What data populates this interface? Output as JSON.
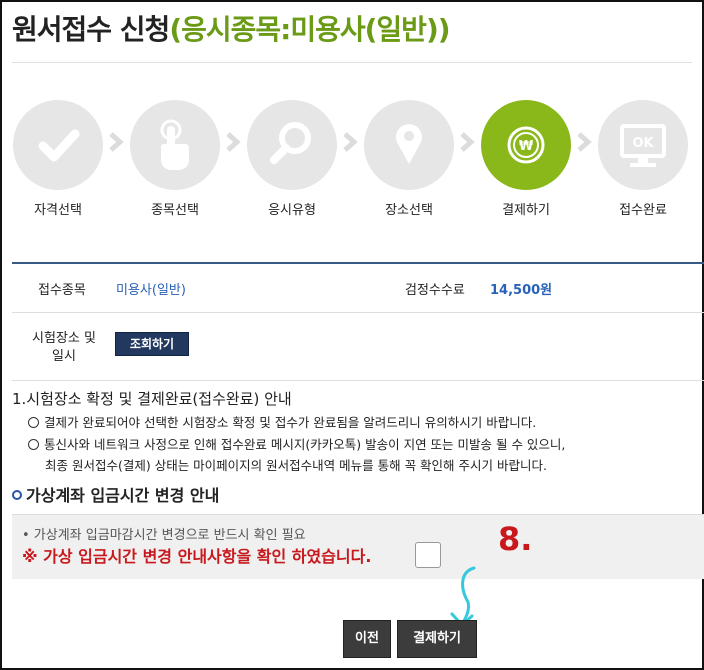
{
  "header": {
    "title_main": "원서접수 신청",
    "title_sub": "(응시종목:미용사(일반))"
  },
  "steps": [
    {
      "label": "자격선택",
      "icon": "check-icon",
      "active": false
    },
    {
      "label": "종목선택",
      "icon": "hand-pointer-icon",
      "active": false
    },
    {
      "label": "응시유형",
      "icon": "magnifier-icon",
      "active": false
    },
    {
      "label": "장소선택",
      "icon": "location-pin-icon",
      "active": false
    },
    {
      "label": "결제하기",
      "icon": "won-coin-icon",
      "active": true
    },
    {
      "label": "접수완료",
      "icon": "ok-monitor-icon",
      "active": false
    }
  ],
  "info": {
    "category_label": "접수종목",
    "category_value": "미용사(일반)",
    "fee_label": "검정수수료",
    "fee_value": "14,500원",
    "place_label_line1": "시험장소 및",
    "place_label_line2": "일시",
    "lookup_button": "조회하기"
  },
  "notice": {
    "title": "1.시험장소 확정 및 결제완료(접수완료) 안내",
    "item1": "결제가 완료되어야 선택한 시험장소 확정 및 접수가 완료됨을 알려드리니 유의하시기 바랍니다.",
    "item2": "통신사와 네트워크 사정으로 인해 접수완료 메시지(카카오톡) 발송이 지연 또는 미발송 될 수 있으니,",
    "item2_cont": "최종 원서접수(결제) 상태는 마이페이지의 원서접수내역 메뉴를 통해 꼭 확인해 주시기 바랍니다."
  },
  "virtual_account": {
    "title": "가상계좌 입금시간 변경 안내",
    "note": "• 가상계좌 입금마감시간 변경으로 반드시 확인 필요",
    "warning": "※ 가상 입금시간 변경 안내사항을 확인 하였습니다.",
    "confirmed": false
  },
  "annotation": {
    "step_number": "8."
  },
  "buttons": {
    "prev": "이전",
    "pay": "결제하기"
  },
  "colors": {
    "active_step": "#8ab81a",
    "inactive_step": "#e6e6e6",
    "title_sub": "#6b9a16",
    "link_blue": "#2a62b8",
    "warning_red": "#c8181c",
    "navy_button": "#22385f",
    "annotation_cyan": "#36c8dc"
  }
}
